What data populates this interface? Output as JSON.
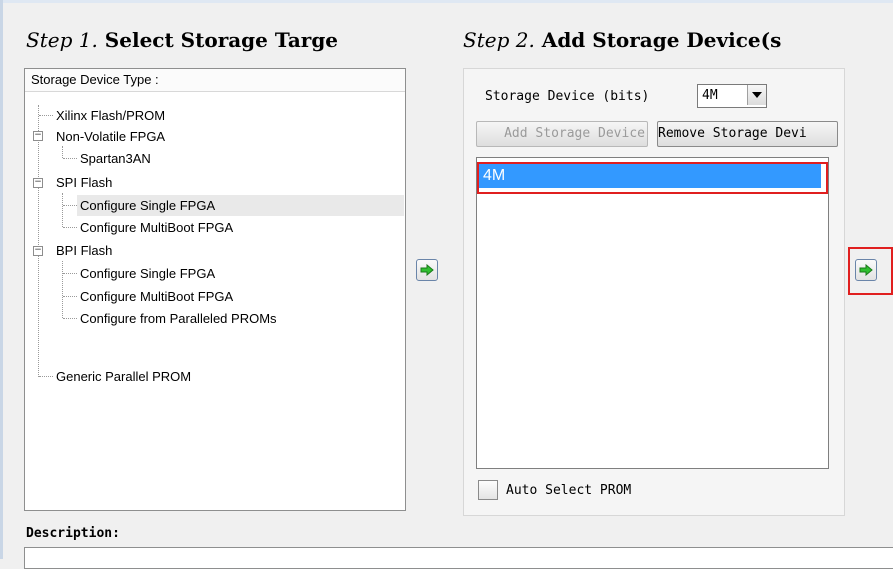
{
  "step1": {
    "prefix": "Step 1.",
    "title": "Select Storage Targe"
  },
  "step2": {
    "prefix": "Step 2.",
    "title": "Add Storage Device(s"
  },
  "tree": {
    "header": "Storage Device Type :",
    "items": [
      {
        "label": "Xilinx Flash/PROM"
      },
      {
        "label": "Non-Volatile FPGA"
      },
      {
        "label": "Spartan3AN"
      },
      {
        "label": "SPI Flash"
      },
      {
        "label": "Configure Single FPGA"
      },
      {
        "label": "Configure MultiBoot FPGA"
      },
      {
        "label": "BPI Flash"
      },
      {
        "label": "Configure Single FPGA"
      },
      {
        "label": "Configure MultiBoot FPGA"
      },
      {
        "label": "Configure from Paralleled PROMs"
      },
      {
        "label": "Generic Parallel PROM"
      }
    ]
  },
  "storage": {
    "size_label": "Storage Device (bits)",
    "size_value": "4M",
    "add_button": "Add Storage Device",
    "remove_button": "Remove Storage Devi",
    "devices": [
      "4M"
    ],
    "auto_select_label": "Auto Select PROM"
  },
  "description": {
    "label": "Description:"
  },
  "colors": {
    "selection": "#3399ff",
    "highlight_border": "#e01f1f",
    "arrow": "#2fbf2f"
  }
}
